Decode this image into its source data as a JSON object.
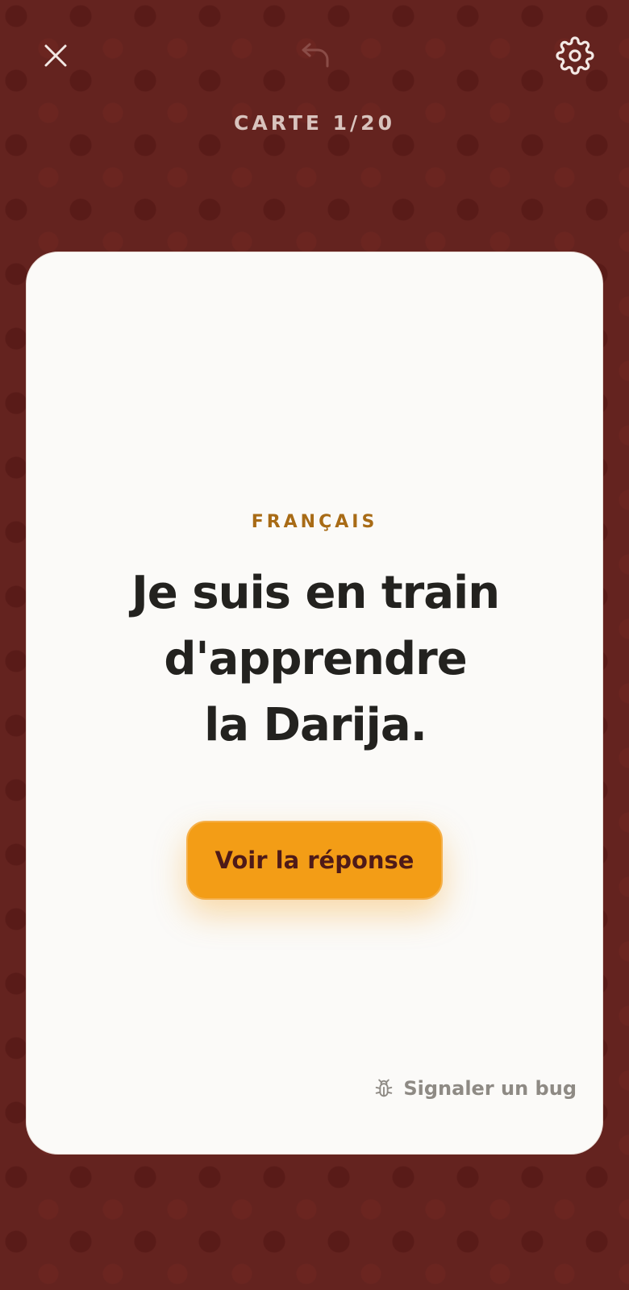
{
  "header": {
    "progress_label": "CARTE 1/20",
    "icons": {
      "close": "close-icon",
      "undo": "undo-icon",
      "settings": "gear-icon"
    }
  },
  "card": {
    "language_label": "FRANÇAIS",
    "phrase_lines": [
      "Je suis en train",
      "d'apprendre",
      "la Darija."
    ],
    "reveal_button_label": "Voir la réponse",
    "report_bug_label": "Signaler un bug",
    "report_bug_icon": "bug-icon"
  },
  "colors": {
    "background": "#64231f",
    "card": "#fbfaf8",
    "accent": "#f39d16",
    "language_label": "#a86b16",
    "text": "#23221f",
    "muted": "#8e8a84"
  }
}
